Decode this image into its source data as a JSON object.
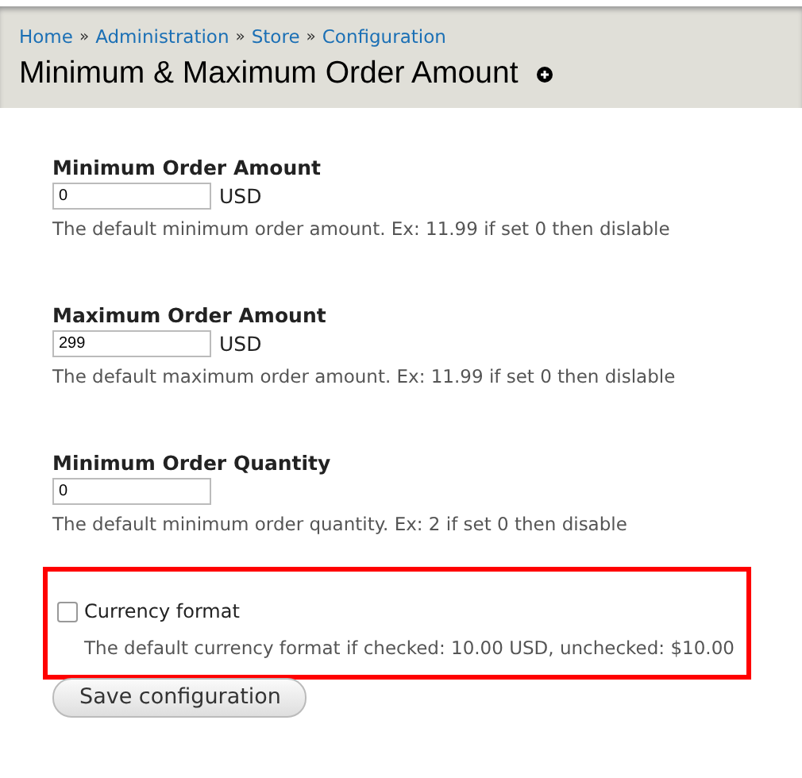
{
  "breadcrumb": [
    "Home",
    "Administration",
    "Store",
    "Configuration"
  ],
  "breadcrumb_separator": "»",
  "page_title": "Minimum & Maximum Order Amount",
  "fields": [
    {
      "label": "Minimum Order Amount",
      "value": "0",
      "suffix": "USD",
      "description": "The default minimum order amount. Ex: 11.99 if set 0 then dislable"
    },
    {
      "label": "Maximum Order Amount",
      "value": "299",
      "suffix": "USD",
      "description": "The default maximum order amount. Ex: 11.99 if set 0 then dislable"
    },
    {
      "label": "Minimum Order Quantity",
      "value": "0",
      "description": "The default minimum order quantity. Ex: 2 if set 0 then disable"
    }
  ],
  "currency_format": {
    "label": "Currency format",
    "checked": false,
    "highlighted": true,
    "description": "The default currency format if checked: 10.00 USD, unchecked: $10.00"
  },
  "save_button": "Save configuration"
}
